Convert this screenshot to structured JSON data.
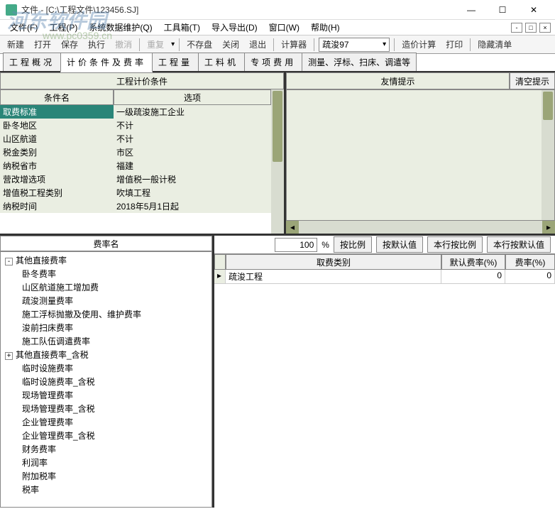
{
  "window": {
    "title": "文件 - [C:\\工程文件\\123456.SJ]",
    "min": "—",
    "max": "☐",
    "close": "✕"
  },
  "watermark": {
    "main": "河东软件园",
    "sub": "www.pc0359.cn"
  },
  "menu": {
    "file": "文件(F)",
    "project": "工程(P)",
    "sysdata": "系统数据维护(Q)",
    "toolbox": "工具箱(T)",
    "importexport": "导入导出(D)",
    "window": "窗口(W)",
    "help": "帮助(H)"
  },
  "toolbar": {
    "new": "新建",
    "open": "打开",
    "save": "保存",
    "run": "执行",
    "undo_cancel": "撤消",
    "redo": "重复",
    "nosave": "不存盘",
    "close": "关闭",
    "exit": "退出",
    "calc": "计算器",
    "combo_val": "疏浚97",
    "pricecalc": "造价计算",
    "print": "打印",
    "hidelist": "隐藏清单"
  },
  "tabs": {
    "t1": "工程概况",
    "t2": "计价条件及费率",
    "t3": "工程量",
    "t4": "工料机",
    "t5": "专项费用",
    "t6": "测量、浮标、扫床、调遣等"
  },
  "cond_panel": {
    "title": "工程计价条件",
    "col_name": "条件名",
    "col_opt": "选项",
    "rows": [
      {
        "name": "取费标准",
        "opt": "一级疏浚施工企业"
      },
      {
        "name": "卧冬地区",
        "opt": "不计"
      },
      {
        "name": "山区航道",
        "opt": "不计"
      },
      {
        "name": "税金类别",
        "opt": "市区"
      },
      {
        "name": "纳税省市",
        "opt": "福建"
      },
      {
        "name": "营改增选项",
        "opt": "增值税一般计税"
      },
      {
        "name": "增值税工程类别",
        "opt": "吹填工程"
      },
      {
        "name": "纳税时间",
        "opt": "2018年5月1日起"
      }
    ]
  },
  "friend_panel": {
    "title": "友情提示",
    "clear": "清空提示"
  },
  "rate_panel": {
    "title": "费率名",
    "tree": [
      {
        "l": 1,
        "exp": "-",
        "label": "其他直接费率"
      },
      {
        "l": 2,
        "label": "卧冬费率"
      },
      {
        "l": 2,
        "label": "山区航道施工增加费"
      },
      {
        "l": 2,
        "label": "疏浚测量费率"
      },
      {
        "l": 2,
        "label": "施工浮标抛撤及使用、维护费率"
      },
      {
        "l": 2,
        "label": "浚前扫床费率"
      },
      {
        "l": 2,
        "label": "施工队伍调遣费率"
      },
      {
        "l": 1,
        "exp": "+",
        "label": "其他直接费率_含税"
      },
      {
        "l": 2,
        "label": "临时设施费率"
      },
      {
        "l": 2,
        "label": "临时设施费率_含税"
      },
      {
        "l": 2,
        "label": "现场管理费率"
      },
      {
        "l": 2,
        "label": "现场管理费率_含税"
      },
      {
        "l": 2,
        "label": "企业管理费率"
      },
      {
        "l": 2,
        "label": "企业管理费率_含税"
      },
      {
        "l": 2,
        "label": "财务费率"
      },
      {
        "l": 2,
        "label": "利润率"
      },
      {
        "l": 2,
        "label": "附加税率"
      },
      {
        "l": 2,
        "label": "税率"
      }
    ]
  },
  "rate_toolbar": {
    "value": "100",
    "pct": "%",
    "b1": "按比例",
    "b2": "按默认值",
    "b3": "本行按比例",
    "b4": "本行按默认值"
  },
  "rate_table": {
    "h1": "取费类别",
    "h2": "默认费率(%)",
    "h3": "费率(%)",
    "rows": [
      {
        "cat": "疏浚工程",
        "def": "0",
        "rate": "0"
      }
    ]
  }
}
